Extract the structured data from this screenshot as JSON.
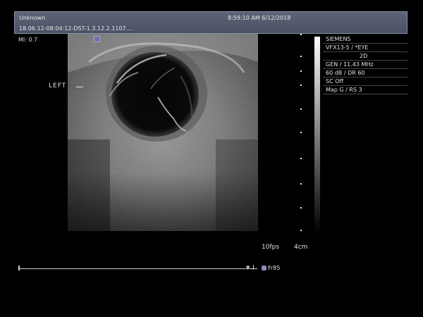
{
  "header": {
    "patient_name": "Unknown",
    "study_id": "18.06.12-08:04:12-DST-1.3.12.2.1107....",
    "datetime": "8:59:10 AM 6/12/2018"
  },
  "overlay": {
    "mi": "MI: 0.7",
    "side_label": "LEFT"
  },
  "info_panel": {
    "lines": [
      "SIEMENS",
      "VFX13-5 / *EYE",
      "2D",
      "GEN / 11.43 MHz",
      "60 dB / DR 60",
      "SC Off",
      "Map G / RS 3"
    ]
  },
  "footer": {
    "fps": "10fps",
    "depth": "4cm",
    "frame": "Fr85"
  },
  "colors": {
    "header_bg": "#555c70",
    "probe_marker": "#6e6cb8",
    "frame_icon": "#8a8ab8"
  },
  "icons": {
    "probe_orientation": "probe-orientation-marker-icon",
    "cine_end": "cine-end-arrow-icon",
    "frame": "frame-counter-icon"
  }
}
